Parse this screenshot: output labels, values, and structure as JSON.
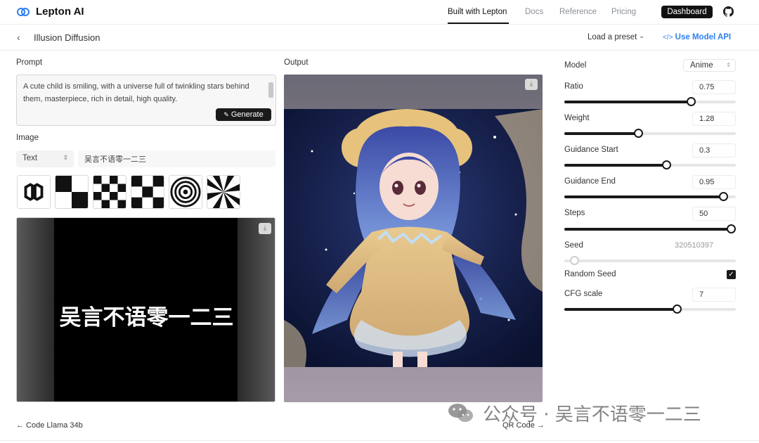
{
  "app": {
    "brand": "Lepton AI",
    "nav": [
      "Built with Lepton",
      "Docs",
      "Reference",
      "Pricing"
    ],
    "dashboard_label": "Dashboard",
    "accent": "#2f80ed"
  },
  "header": {
    "title": "Illusion Diffusion",
    "preset_label": "Load a preset",
    "api_label": "Use Model API",
    "api_prefix": "</>"
  },
  "prompt": {
    "label": "Prompt",
    "value": "A cute child is smiling, with a universe full of twinkling stars behind them, masterpiece, rich in detail, high quality.",
    "generate_label": "Generate"
  },
  "image": {
    "label": "Image",
    "mode": "Text",
    "text_value": "吴言不语零一二三",
    "preview_text": "吴言不语零一二三",
    "patterns": [
      "rings",
      "checker-2",
      "checker-4",
      "checker-3",
      "spiral",
      "rays"
    ]
  },
  "output": {
    "label": "Output"
  },
  "params": {
    "model_label": "Model",
    "model_value": "Anime",
    "ratio_label": "Ratio",
    "ratio_value": "0.75",
    "weight_label": "Weight",
    "weight_value": "1.28",
    "gstart_label": "Guidance Start",
    "gstart_value": "0.3",
    "gend_label": "Guidance End",
    "gend_value": "0.95",
    "steps_label": "Steps",
    "steps_value": "50",
    "seed_label": "Seed",
    "seed_value": "320510397",
    "random_seed_label": "Random Seed",
    "random_seed_checked": true,
    "cfg_label": "CFG scale",
    "cfg_value": "7"
  },
  "footer": {
    "prev": "← Code Llama 34b",
    "next": "QR Code →"
  },
  "watermark": {
    "text": "公众号 · 吴言不语零一二三"
  }
}
